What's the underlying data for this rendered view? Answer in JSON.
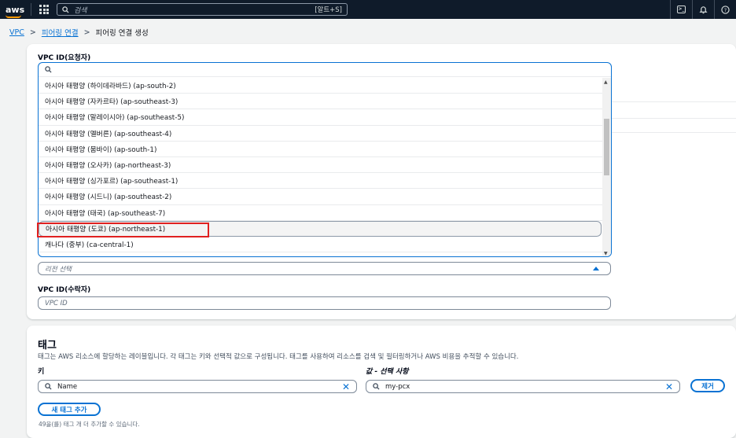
{
  "topbar": {
    "logo": "aws",
    "search_placeholder": "검색",
    "search_shortcut": "[알트+S]",
    "cloudshell_icon": "terminal-icon",
    "bell_icon": "bell-icon",
    "help_icon": "help-icon",
    "accent_color": "#ff9900"
  },
  "breadcrumb": {
    "items": [
      "VPC",
      "피어링 연결"
    ],
    "current": "피어링 연결 생성"
  },
  "requester": {
    "label": "VPC ID(요청자)"
  },
  "region_dropdown": {
    "search_value": "",
    "options": [
      "아시아 태평양 (하이데라바드) (ap-south-2)",
      "아시아 태평양 (자카르타) (ap-southeast-3)",
      "아시아 태평양 (말레이시아) (ap-southeast-5)",
      "아시아 태평양 (멜버른) (ap-southeast-4)",
      "아시아 태평양 (뭄바이) (ap-south-1)",
      "아시아 태평양 (오사카) (ap-northeast-3)",
      "아시아 태평양 (싱가포르) (ap-southeast-1)",
      "아시아 태평양 (시드니) (ap-southeast-2)",
      "아시아 태평양 (태국) (ap-southeast-7)",
      "아시아 태평양 (도쿄) (ap-northeast-1)",
      "캐나다 (중부) (ca-central-1)"
    ],
    "highlighted_index": 9,
    "select_placeholder": "리전 선택",
    "highlight_color": "#e02020"
  },
  "accepter": {
    "label": "VPC ID(수락자)",
    "placeholder": "VPC ID"
  },
  "tags": {
    "title": "태그",
    "description": "태그는 AWS 리소스에 할당하는 레이블입니다. 각 태그는 키와 선택적 값으로 구성됩니다. 태그를 사용하여 리소스를 검색 및 필터링하거나 AWS 비용을 추적할 수 있습니다.",
    "key_label": "키",
    "value_label": "값 - 선택 사항",
    "key_value": "Name",
    "value_value": "my-pcx",
    "remove_label": "제거",
    "add_label": "새 태그 추가",
    "note": "49을(를) 태그 개 더 추가할 수 있습니다."
  }
}
